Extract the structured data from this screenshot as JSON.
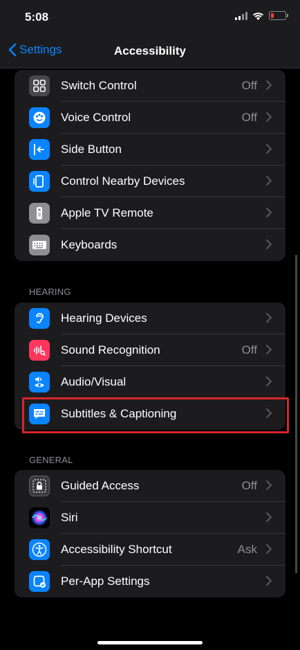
{
  "status_bar": {
    "time": "5:08",
    "battery_color": "#ff3b30"
  },
  "nav": {
    "back_label": "Settings",
    "title": "Accessibility"
  },
  "groups": {
    "physical": [
      {
        "label": "Switch Control",
        "value": "Off",
        "icon": "switch-control-icon",
        "color": "#636366"
      },
      {
        "label": "Voice Control",
        "value": "Off",
        "icon": "voice-control-icon",
        "color": "#0a84ff"
      },
      {
        "label": "Side Button",
        "value": "",
        "icon": "side-button-icon",
        "color": "#0a84ff"
      },
      {
        "label": "Control Nearby Devices",
        "value": "",
        "icon": "nearby-devices-icon",
        "color": "#0a84ff"
      },
      {
        "label": "Apple TV Remote",
        "value": "",
        "icon": "tv-remote-icon",
        "color": "#8e8e93"
      },
      {
        "label": "Keyboards",
        "value": "",
        "icon": "keyboard-icon",
        "color": "#8e8e93"
      }
    ],
    "hearing_header": "HEARING",
    "hearing": [
      {
        "label": "Hearing Devices",
        "value": "",
        "icon": "ear-icon",
        "color": "#0a84ff"
      },
      {
        "label": "Sound Recognition",
        "value": "Off",
        "icon": "sound-recognition-icon",
        "color": "#ff375f"
      },
      {
        "label": "Audio/Visual",
        "value": "",
        "icon": "audio-visual-icon",
        "color": "#0a84ff"
      },
      {
        "label": "Subtitles & Captioning",
        "value": "",
        "icon": "captions-icon",
        "color": "#0a84ff"
      }
    ],
    "general_header": "GENERAL",
    "general": [
      {
        "label": "Guided Access",
        "value": "Off",
        "icon": "guided-access-icon",
        "color": "#3a3a3c"
      },
      {
        "label": "Siri",
        "value": "",
        "icon": "siri-icon",
        "color": "#000000"
      },
      {
        "label": "Accessibility Shortcut",
        "value": "Ask",
        "icon": "accessibility-icon",
        "color": "#0a84ff"
      },
      {
        "label": "Per-App Settings",
        "value": "",
        "icon": "per-app-icon",
        "color": "#0a84ff"
      }
    ]
  },
  "highlight_color": "#d9242b"
}
